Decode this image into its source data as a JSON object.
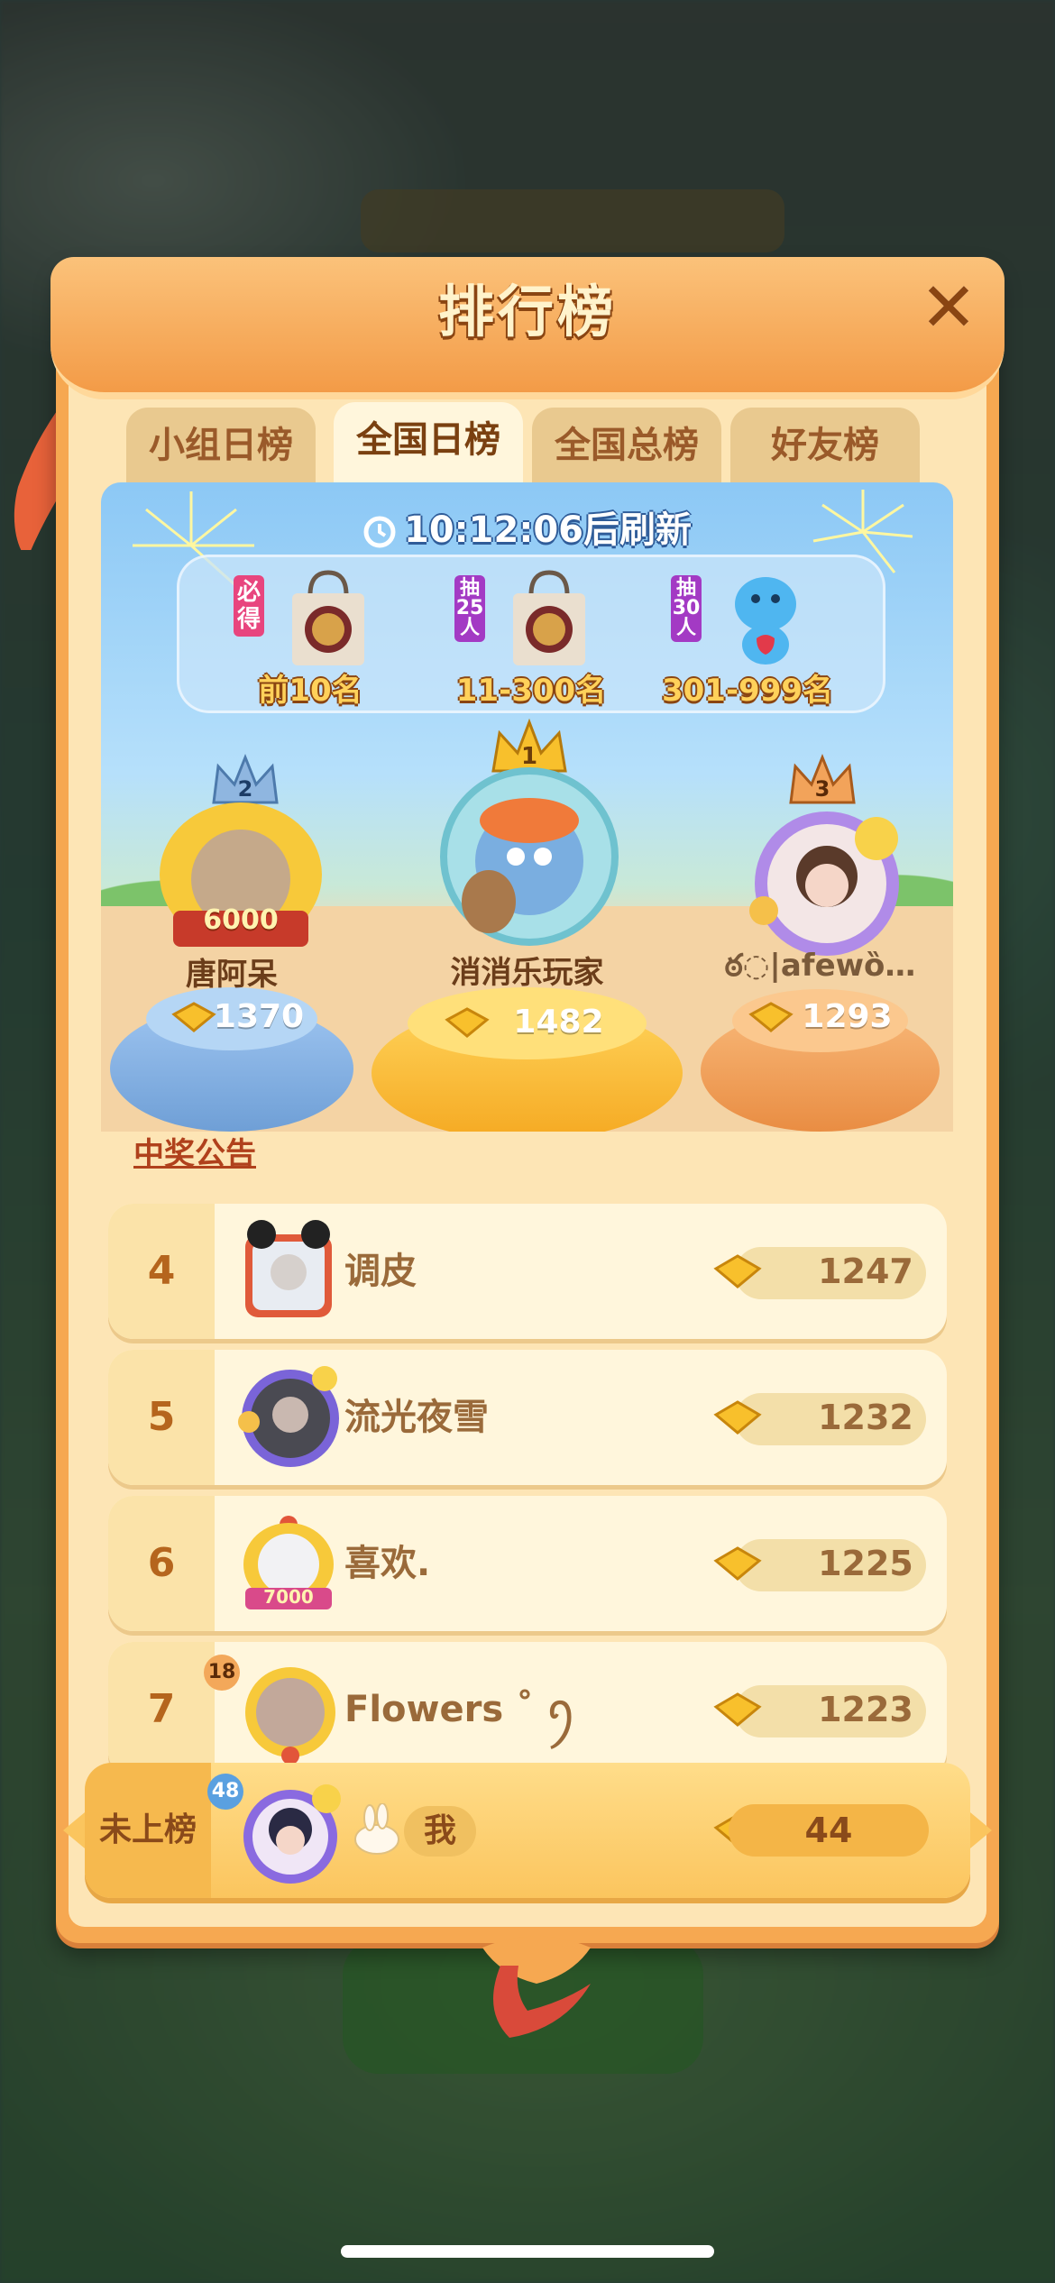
{
  "title": "排行榜",
  "tabs": [
    {
      "label": "小组日榜",
      "active": false
    },
    {
      "label": "全国日榜",
      "active": true
    },
    {
      "label": "全国总榜",
      "active": false
    },
    {
      "label": "好友榜",
      "active": false
    }
  ],
  "timer": {
    "time": "10:12:06",
    "suffix": "后刷新"
  },
  "rewards": [
    {
      "tag": "必得",
      "label": "前10名",
      "icon": "gift-bag-icon"
    },
    {
      "tag": "抽25人",
      "label": "11-300名",
      "icon": "gift-bag-icon"
    },
    {
      "tag": "抽30人",
      "label": "301-999名",
      "icon": "blue-hippo-plush-icon"
    }
  ],
  "podium": [
    {
      "rank": "2",
      "name": "唐阿呆",
      "score": "1370",
      "avatar_badge": "6000"
    },
    {
      "rank": "1",
      "name": "消消乐玩家",
      "score": "1482"
    },
    {
      "rank": "3",
      "name": "ఠ◌|afewȍ…",
      "score": "1293"
    }
  ],
  "notice_link": "中奖公告",
  "rows": [
    {
      "rank": "4",
      "name": "调皮",
      "score": "1247"
    },
    {
      "rank": "5",
      "name": "流光夜雪",
      "score": "1232"
    },
    {
      "rank": "6",
      "name": "喜欢.",
      "score": "1225",
      "avatar_badge": "7000"
    },
    {
      "rank": "7",
      "name": "Flowers ˚ ꪆ",
      "score": "1223",
      "level": "18"
    }
  ],
  "me": {
    "rank_label": "未上榜",
    "name": "我",
    "score": "44",
    "level": "48"
  },
  "colors": {
    "panel": "#f6a851",
    "accent_gold": "#ffd15a",
    "text_brown": "#9a6a3a"
  }
}
